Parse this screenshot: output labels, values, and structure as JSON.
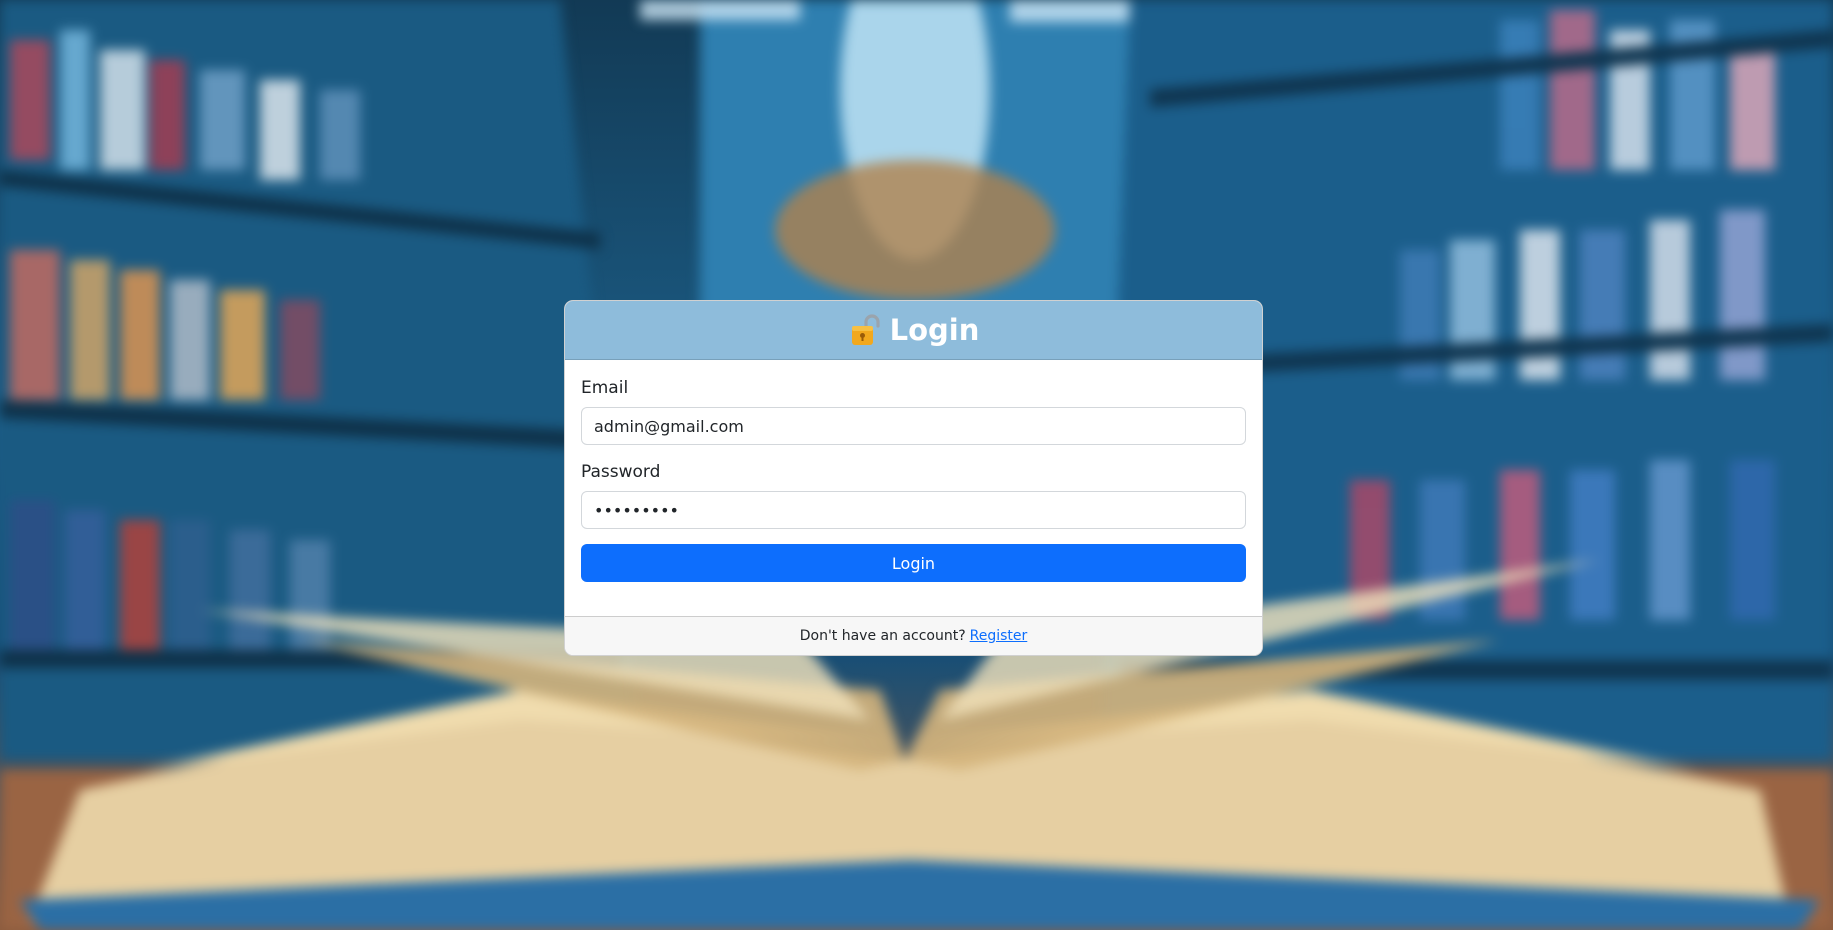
{
  "login_card": {
    "title": "Login",
    "title_icon": "lock-open-icon",
    "email": {
      "label": "Email",
      "value": "admin@gmail.com"
    },
    "password": {
      "label": "Password",
      "value": "•••••••••"
    },
    "submit_label": "Login",
    "footer": {
      "prompt": "Don't have an account?",
      "link_text": "Register"
    }
  },
  "colors": {
    "header_bg": "#8ebcdb",
    "button_bg": "#0d6efd",
    "link": "#0d6efd"
  }
}
